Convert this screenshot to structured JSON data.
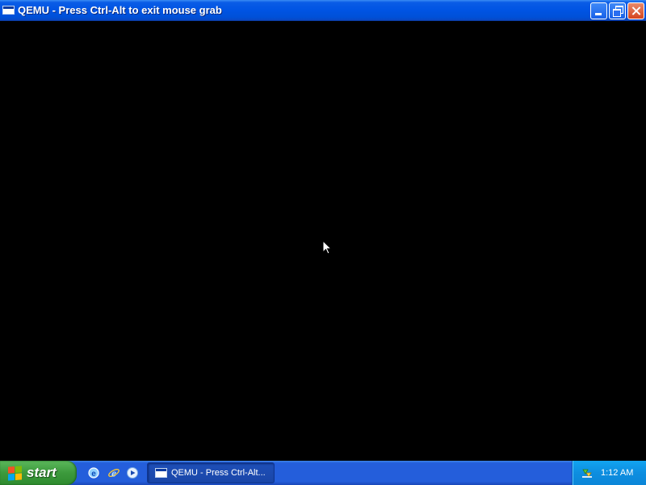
{
  "window": {
    "title": "QEMU - Press Ctrl-Alt to exit mouse grab"
  },
  "titlebar_buttons": {
    "minimize_icon": "minimize-icon",
    "restore_icon": "restore-icon",
    "close_icon": "close-icon"
  },
  "taskbar": {
    "start_label": "start",
    "quick_launch": [
      "ie-icon",
      "ie-icon",
      "media-player-icon"
    ],
    "task_button_label": "QEMU - Press Ctrl-Alt...",
    "clock": "1:12 AM",
    "tray_icon": "network-icon"
  },
  "colors": {
    "titlebar": "#0054e3",
    "taskbar": "#245edb",
    "start_button": "#3c9a3c",
    "tray": "#0d8ee0",
    "screen": "#000000"
  }
}
